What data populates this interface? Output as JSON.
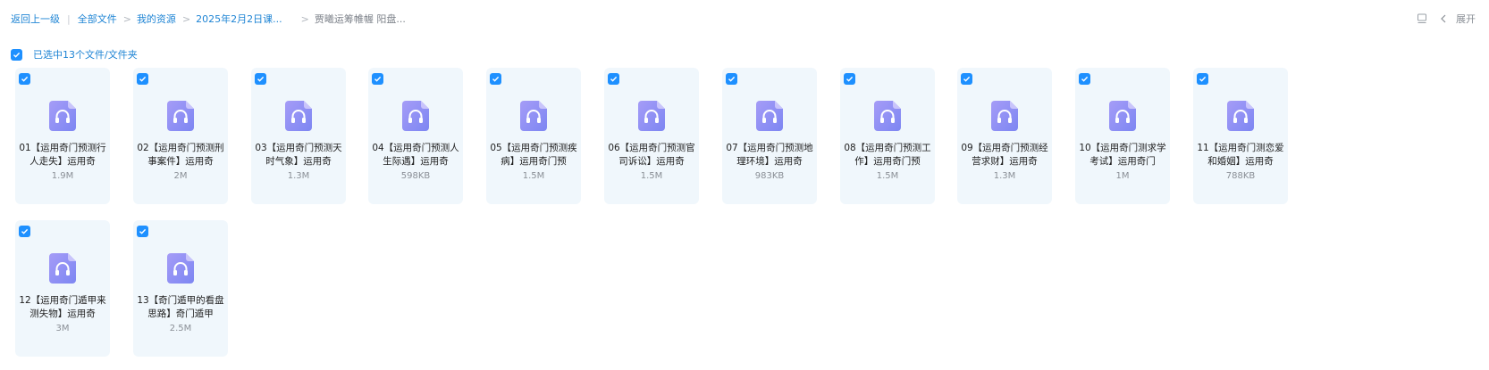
{
  "breadcrumb": {
    "back": "返回上一级",
    "items": [
      "全部文件",
      "我的资源",
      "2025年2月2日课..."
    ],
    "current": "贾曦运筹帷幄 阳盘..."
  },
  "toolbar": {
    "layout_icon": "layout-icon",
    "collapse_icon": "chevron-left-icon",
    "expand_label": "展开"
  },
  "selection": {
    "text": "已选中13个文件/文件夹",
    "checked": true
  },
  "colors": {
    "accent": "#1e90ff",
    "link": "#1e84d4",
    "card_bg": "#f0f7fc",
    "audio_icon": "#8a86f5"
  },
  "files": [
    {
      "name": "01【运用奇门预测行人走失】运用奇",
      "size": "1.9M",
      "icon": "audio-file-icon",
      "checked": true
    },
    {
      "name": "02【运用奇门预测刑事案件】运用奇",
      "size": "2M",
      "icon": "audio-file-icon",
      "checked": true
    },
    {
      "name": "03【运用奇门预测天时气象】运用奇",
      "size": "1.3M",
      "icon": "audio-file-icon",
      "checked": true
    },
    {
      "name": "04【运用奇门预测人生际遇】运用奇",
      "size": "598KB",
      "icon": "audio-file-icon",
      "checked": true
    },
    {
      "name": "05【运用奇门预测疾病】运用奇门预",
      "size": "1.5M",
      "icon": "audio-file-icon",
      "checked": true
    },
    {
      "name": "06【运用奇门预测官司诉讼】运用奇",
      "size": "1.5M",
      "icon": "audio-file-icon",
      "checked": true
    },
    {
      "name": "07【运用奇门预测地理环境】运用奇",
      "size": "983KB",
      "icon": "audio-file-icon",
      "checked": true
    },
    {
      "name": "08【运用奇门预测工作】运用奇门预",
      "size": "1.5M",
      "icon": "audio-file-icon",
      "checked": true
    },
    {
      "name": "09【运用奇门预测经营求财】运用奇",
      "size": "1.3M",
      "icon": "audio-file-icon",
      "checked": true
    },
    {
      "name": "10【运用奇门测求学考试】运用奇门",
      "size": "1M",
      "icon": "audio-file-icon",
      "checked": true
    },
    {
      "name": "11【运用奇门测恋爱和婚姻】运用奇",
      "size": "788KB",
      "icon": "audio-file-icon",
      "checked": true
    },
    {
      "name": "12【运用奇门遁甲来测失物】运用奇",
      "size": "3M",
      "icon": "audio-file-icon",
      "checked": true
    },
    {
      "name": "13【奇门遁甲的看盘思路】奇门遁甲",
      "size": "2.5M",
      "icon": "audio-file-icon",
      "checked": true
    }
  ]
}
